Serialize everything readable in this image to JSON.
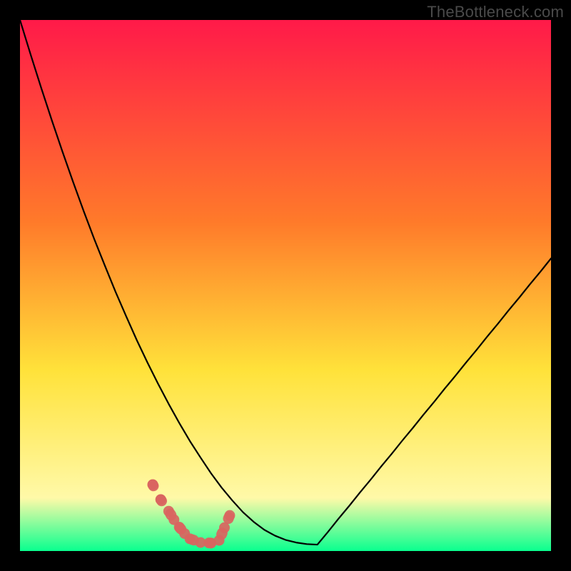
{
  "watermark": "TheBottleneck.com",
  "colors": {
    "bg": "#000000",
    "grad_top": "#ff1a49",
    "grad_mid1": "#ff7a2a",
    "grad_mid2": "#ffe23a",
    "grad_mid3": "#fff9a8",
    "grad_bottom": "#09ff8f",
    "curve": "#000000",
    "marker_fill": "#d9645f",
    "marker_stroke": "#d9645f"
  },
  "chart_data": {
    "type": "line",
    "title": "",
    "xlabel": "",
    "ylabel": "",
    "xlim": [
      0,
      100
    ],
    "ylim": [
      0,
      100
    ],
    "x": [
      0,
      2,
      4,
      6,
      8,
      10,
      12,
      14,
      16,
      18,
      20,
      22,
      24,
      26,
      28,
      30,
      32,
      34,
      36,
      38,
      40,
      42,
      44,
      46,
      48,
      50,
      52,
      54,
      56,
      58,
      60,
      62,
      64,
      66,
      68,
      70,
      72,
      74,
      76,
      78,
      80,
      82,
      84,
      86,
      88,
      90,
      92,
      94,
      96,
      98,
      100
    ],
    "values": [
      100.0,
      93.5,
      87.2,
      81.1,
      75.2,
      69.5,
      64.0,
      58.7,
      53.7,
      48.8,
      44.2,
      39.7,
      35.5,
      31.5,
      27.7,
      24.1,
      20.7,
      17.6,
      14.6,
      11.9,
      9.5,
      7.3,
      5.5,
      4.0,
      2.9,
      2.1,
      1.6,
      1.3,
      1.2,
      3.6,
      6.1,
      8.5,
      11.0,
      13.4,
      15.9,
      18.3,
      20.8,
      23.2,
      25.7,
      28.1,
      30.6,
      33.0,
      35.5,
      37.9,
      40.4,
      42.8,
      45.3,
      47.7,
      50.2,
      52.6,
      55.1
    ],
    "markers": {
      "x": [
        25,
        26.5,
        28,
        29,
        30,
        31,
        32,
        34,
        36,
        37.5,
        38.5,
        39.5
      ],
      "y": [
        12.5,
        9.7,
        7.5,
        5.9,
        4.5,
        3.3,
        2.3,
        1.6,
        1.5,
        2.0,
        4.4,
        6.7
      ]
    }
  }
}
